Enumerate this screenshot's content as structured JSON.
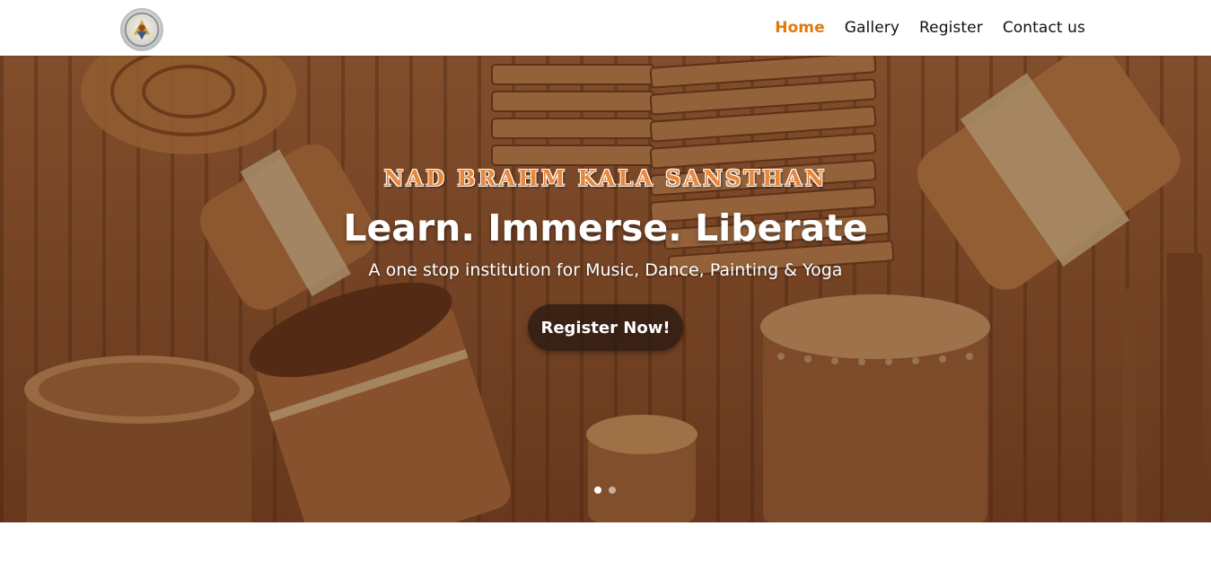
{
  "header": {
    "logo_alt": "Nad Brahm Kala Sansthan logo",
    "nav": [
      {
        "label": "Home",
        "active": true
      },
      {
        "label": "Gallery",
        "active": false
      },
      {
        "label": "Register",
        "active": false
      },
      {
        "label": "Contact us",
        "active": false
      }
    ],
    "active_color": "#e2790c"
  },
  "hero": {
    "eyebrow": "NAD BRAHM KALA SANSTHAN",
    "headline": "Learn. Immerse. Liberate",
    "subline": "A one stop institution for Music, Dance, Painting & Yoga",
    "cta_label": "Register Now!",
    "background_image": "african-drums-and-wooden-instruments",
    "slides": 2,
    "active_slide": 1
  },
  "colors": {
    "accent": "#e2790c",
    "eyebrow": "#e8873a",
    "cta_bg": "#2d1c12"
  }
}
